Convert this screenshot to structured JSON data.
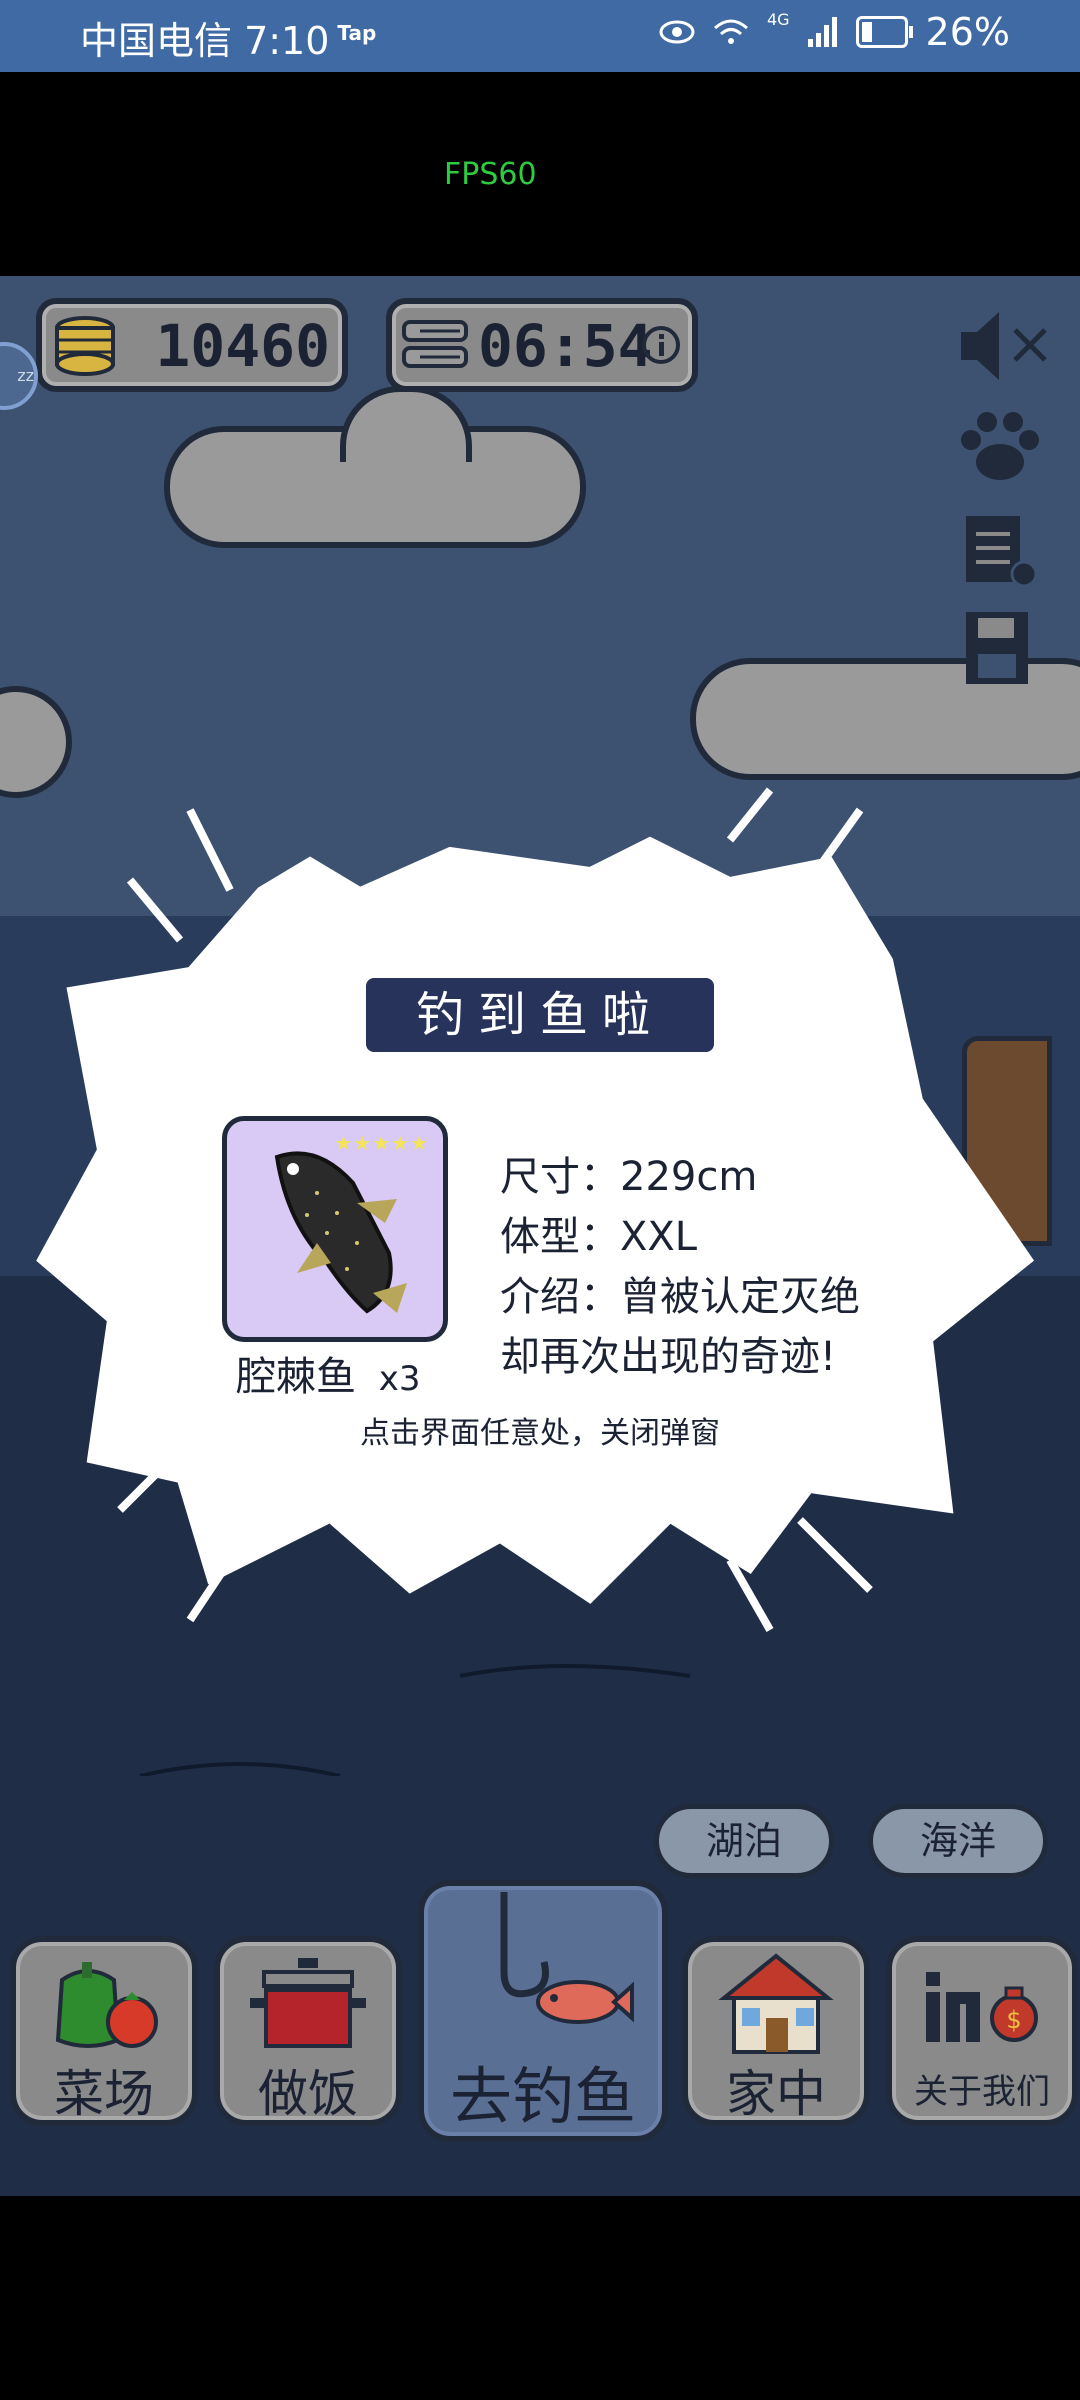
{
  "status_bar": {
    "carrier_time": "中国电信 7:10",
    "tap_badge": "Tap",
    "network": "4G",
    "battery": "26%",
    "battery_level": 0.26
  },
  "overlay": {
    "fps": "FPS60"
  },
  "hud": {
    "coins": "10460",
    "timer": "06:54"
  },
  "popup": {
    "title": "钓到鱼啦",
    "fish_name": "腔棘鱼",
    "fish_count": "x3",
    "stars": "★★★★★",
    "size": "尺寸：229cm",
    "body_type": "体型：XXL",
    "intro_line1": "介绍：曾被认定灭绝",
    "intro_line2": "却再次出现的奇迹!",
    "close_hint": "点击界面任意处，关闭弹窗"
  },
  "fishing_spots": [
    {
      "label": "湖泊"
    },
    {
      "label": "海洋"
    }
  ],
  "nav": [
    {
      "label": "菜场"
    },
    {
      "label": "做饭"
    },
    {
      "label": "去钓鱼"
    },
    {
      "label": "家中"
    },
    {
      "label": "关于我们"
    }
  ],
  "side_icon": {
    "label": "zz"
  },
  "colors": {
    "sky": "#3c5270",
    "sea": "#1f2d47",
    "popup_title_bg": "#27335a",
    "fish_card_bg": "#d9c9f5"
  }
}
